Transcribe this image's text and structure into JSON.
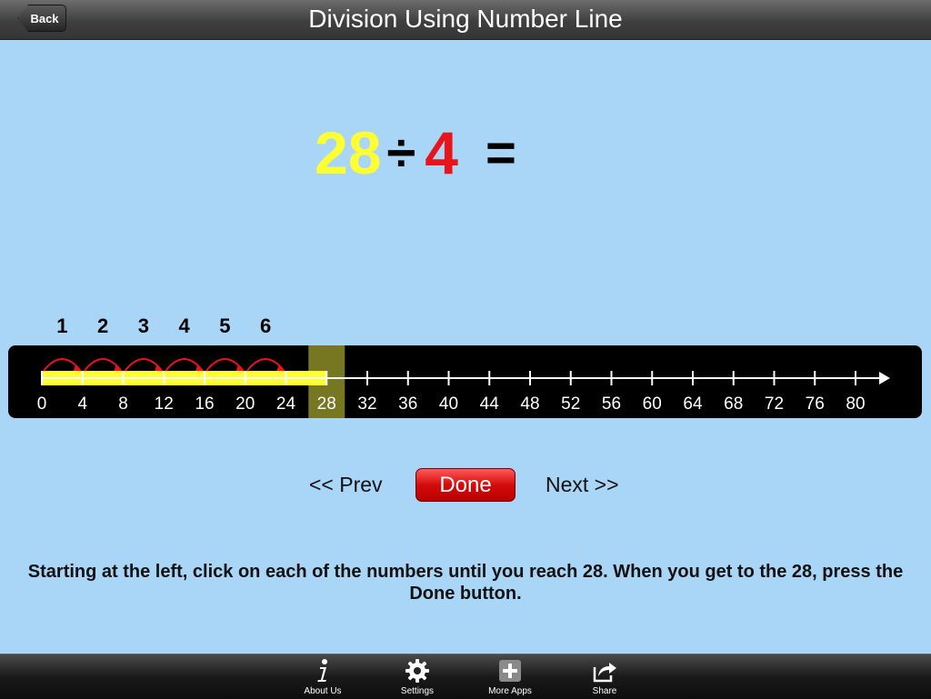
{
  "header": {
    "title": "Division Using Number Line",
    "back_label": "Back"
  },
  "equation": {
    "dividend": "28",
    "operator": "÷",
    "divisor": "4",
    "equals": "="
  },
  "number_line": {
    "tick_labels": [
      "0",
      "4",
      "8",
      "12",
      "16",
      "20",
      "24",
      "28",
      "32",
      "36",
      "40",
      "44",
      "48",
      "52",
      "56",
      "60",
      "64",
      "68",
      "72",
      "76",
      "80"
    ],
    "step_labels": [
      "1",
      "2",
      "3",
      "4",
      "5",
      "6"
    ],
    "highlighted_value": "28",
    "jumps_completed": 6,
    "colors": {
      "fill": "#ffff33",
      "arc": "#e8141c",
      "highlight": "#777722"
    }
  },
  "controls": {
    "prev_label": "<< Prev",
    "done_label": "Done",
    "next_label": "Next >>"
  },
  "instructions": "Starting at the left, click on each of the numbers until you reach 28. When you get to the 28, press the Done button.",
  "tabbar": {
    "items": [
      {
        "label": "About Us",
        "icon": "info-icon"
      },
      {
        "label": "Settings",
        "icon": "gear-icon"
      },
      {
        "label": "More Apps",
        "icon": "plus-icon"
      },
      {
        "label": "Share",
        "icon": "share-icon"
      }
    ]
  }
}
